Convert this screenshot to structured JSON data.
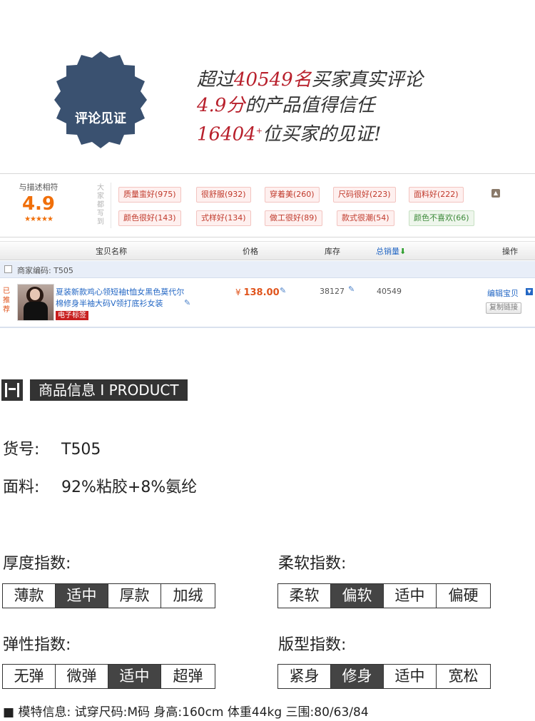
{
  "hero": {
    "badge_score": "4.9",
    "badge_label": "评论见证",
    "line1_prefix": "超过",
    "line1_num": "40549名",
    "line1_suffix": "买家真实评论",
    "line2_num": "4.9分",
    "line2_suffix": "的产品值得信任",
    "line3_num": "16404",
    "line3_sup": "+",
    "line3_suffix": "位买家的见证!",
    "colors": {
      "badge": "#3a5170",
      "accent": "#b8202c"
    }
  },
  "rating": {
    "caption": "与描述相符",
    "score": "4.9",
    "stars": "★★★★★",
    "side_label": "大家都写到",
    "tags_row1": [
      "质量蛮好(975)",
      "很舒服(932)",
      "穿着美(260)",
      "尺码很好(223)",
      "面料好(222)"
    ],
    "tags_row2": [
      "颜色很好(143)",
      "式样好(134)",
      "做工很好(89)",
      "款式很潮(54)",
      "颜色不喜欢(66)"
    ],
    "collapse_icon": "chevron-up-icon"
  },
  "table": {
    "headers": {
      "name": "宝贝名称",
      "price": "价格",
      "stock": "库存",
      "sales": "总销量",
      "action": "操作"
    },
    "code_label": "商家编码: T505",
    "item": {
      "recommend": "已推荐",
      "title": "夏装新款鸡心领短袖t恤女黑色莫代尔棉修身半袖大码V领打底衫女装",
      "e_tag": "电子标签",
      "price_symbol": "¥",
      "price": "138.00",
      "stock": "38127",
      "sales": "40549",
      "edit": "编辑宝贝",
      "copy": "复制链接"
    }
  },
  "product": {
    "section_title": "商品信息 I PRODUCT",
    "sku_key": "货号:",
    "sku_val": "T505",
    "fabric_key": "面料:",
    "fabric_val": "92%粘胶+8%氨纶",
    "indices": {
      "thickness": {
        "label": "厚度指数:",
        "options": [
          "薄款",
          "适中",
          "厚款",
          "加绒"
        ],
        "selected": 1
      },
      "softness": {
        "label": "柔软指数:",
        "options": [
          "柔软",
          "偏软",
          "适中",
          "偏硬"
        ],
        "selected": 1
      },
      "elasticity": {
        "label": "弹性指数:",
        "options": [
          "无弹",
          "微弹",
          "适中",
          "超弹"
        ],
        "selected": 2
      },
      "fit": {
        "label": "版型指数:",
        "options": [
          "紧身",
          "修身",
          "适中",
          "宽松"
        ],
        "selected": 1
      }
    },
    "model_info": "■ 模特信息: 试穿尺码:M码 身高:160cm 体重44kg 三围:80/63/84"
  }
}
